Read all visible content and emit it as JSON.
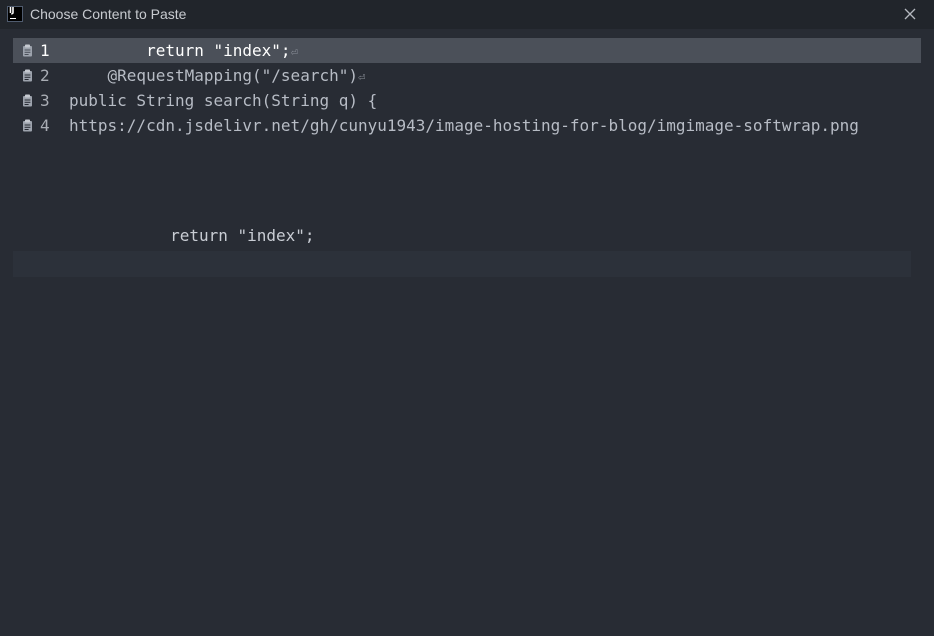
{
  "window": {
    "title": "Choose Content to Paste",
    "app_icon": "intellij-idea-icon",
    "close_icon": "close-icon"
  },
  "clipboard_items": [
    {
      "number": "1",
      "text": "        return \"index\";",
      "eol": "⏎",
      "icon": "clipboard-icon",
      "selected": true
    },
    {
      "number": "2",
      "text": "    @RequestMapping(\"/search\")",
      "eol": "⏎",
      "icon": "clipboard-icon",
      "selected": false
    },
    {
      "number": "3",
      "text": "public String search(String q) {",
      "eol": "",
      "icon": "clipboard-icon",
      "selected": false
    },
    {
      "number": "4",
      "text": "https://cdn.jsdelivr.net/gh/cunyu1943/image-hosting-for-blog/imgimage-softwrap.png",
      "eol": "",
      "icon": "clipboard-icon",
      "selected": false
    }
  ],
  "preview": {
    "line": "        return \"index\";"
  },
  "colors": {
    "background": "#282c34",
    "titlebar": "#21252b",
    "selection": "#4b5059",
    "text": "#b7bcc5"
  }
}
